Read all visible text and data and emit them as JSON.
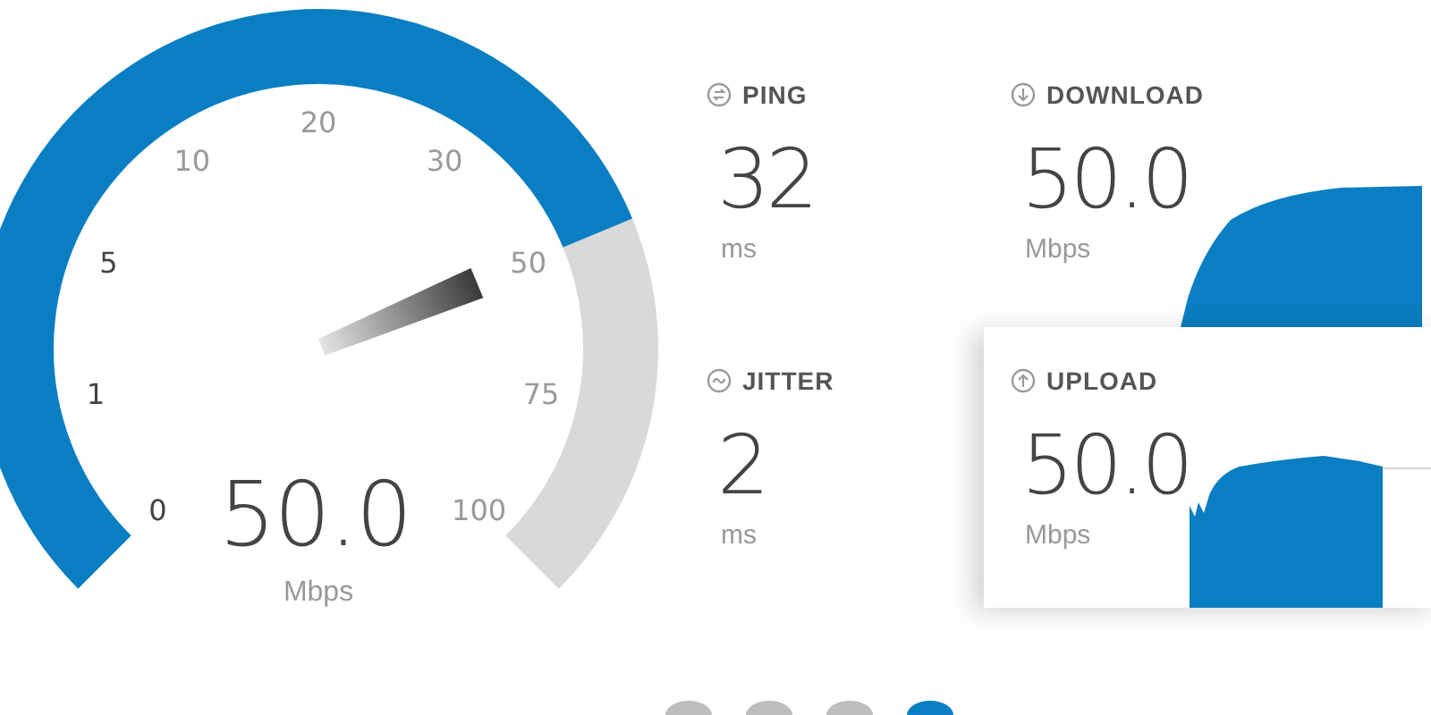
{
  "gauge": {
    "labels": [
      {
        "text": "0",
        "dim": false
      },
      {
        "text": "1",
        "dim": false
      },
      {
        "text": "5",
        "dim": false
      },
      {
        "text": "10",
        "dim": true
      },
      {
        "text": "20",
        "dim": true
      },
      {
        "text": "30",
        "dim": true
      },
      {
        "text": "50",
        "dim": true
      },
      {
        "text": "75",
        "dim": true
      },
      {
        "text": "100",
        "dim": true
      }
    ],
    "value": "50.0",
    "unit": "Mbps"
  },
  "stats": [
    {
      "kind": "ping",
      "label": "PING",
      "value": "32",
      "unit": "ms"
    },
    {
      "kind": "download",
      "label": "DOWNLOAD",
      "value": "50.0",
      "unit": "Mbps"
    },
    {
      "kind": "jitter",
      "label": "JITTER",
      "value": "2",
      "unit": "ms"
    },
    {
      "kind": "upload",
      "label": "UPLOAD",
      "value": "50.0",
      "unit": "Mbps"
    }
  ],
  "pager": [
    {
      "selected": false
    },
    {
      "selected": false
    },
    {
      "selected": false
    },
    {
      "selected": true
    }
  ]
}
